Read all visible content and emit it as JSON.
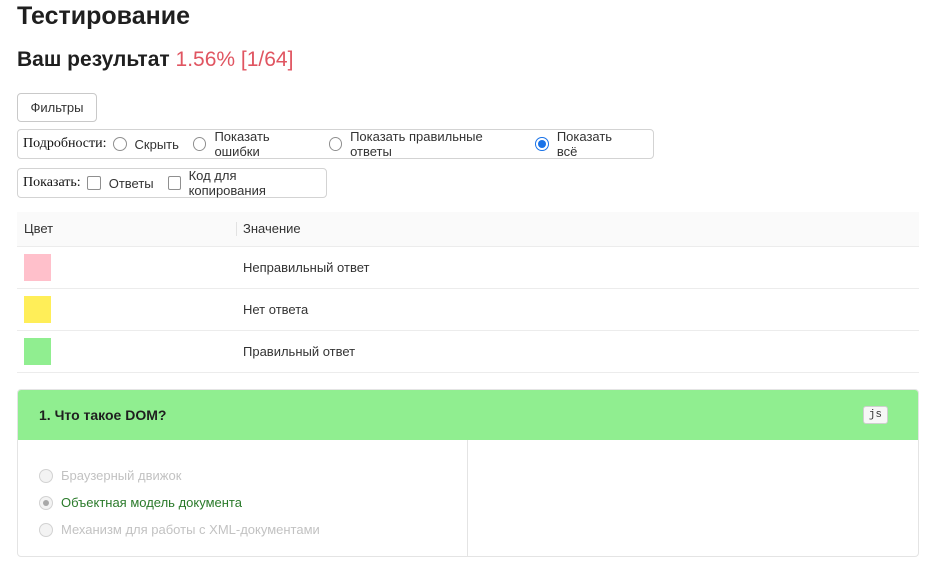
{
  "page": {
    "title": "Тестирование",
    "result_label": "Ваш результат",
    "result_score": "1.56% [1/64]"
  },
  "filters": {
    "button_label": "Фильтры"
  },
  "details": {
    "label": "Подробности:",
    "options": [
      {
        "label": "Скрыть",
        "selected": false
      },
      {
        "label": "Показать ошибки",
        "selected": false
      },
      {
        "label": "Показать правильные ответы",
        "selected": false
      },
      {
        "label": "Показать всё",
        "selected": true
      }
    ]
  },
  "show": {
    "label": "Показать:",
    "options": [
      {
        "label": "Ответы",
        "checked": false
      },
      {
        "label": "Код для копирования",
        "checked": false
      }
    ]
  },
  "legend": {
    "headers": {
      "color": "Цвет",
      "value": "Значение"
    },
    "rows": [
      {
        "color": "#ffc0cb",
        "label": "Неправильный ответ"
      },
      {
        "color": "#ffee58",
        "label": "Нет ответа"
      },
      {
        "color": "#90ee90",
        "label": "Правильный ответ"
      }
    ]
  },
  "question": {
    "title": "1. Что такое DOM?",
    "tag": "js",
    "header_color": "#90ee90",
    "answers": [
      {
        "label": "Браузерный движок",
        "selected": false,
        "correct": false
      },
      {
        "label": "Объектная модель документа",
        "selected": true,
        "correct": true
      },
      {
        "label": "Механизм для работы с XML-документами",
        "selected": false,
        "correct": false
      }
    ]
  }
}
